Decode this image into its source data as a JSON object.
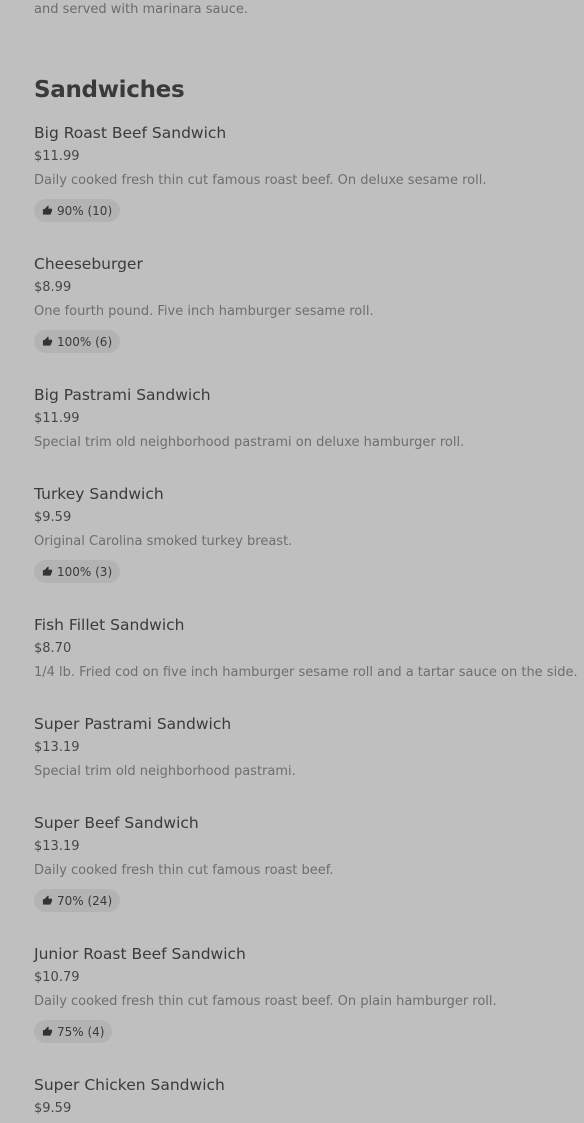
{
  "previous_item": {
    "description_tail": "and served with marinara sauce."
  },
  "section": {
    "title": "Sandwiches"
  },
  "items": [
    {
      "name": "Big Roast Beef Sandwich",
      "price": "$11.99",
      "description": "Daily cooked fresh thin cut famous roast beef. On deluxe sesame roll.",
      "rating": "90% (10)"
    },
    {
      "name": "Cheeseburger",
      "price": "$8.99",
      "description": "One fourth pound. Five inch hamburger sesame roll.",
      "rating": "100% (6)"
    },
    {
      "name": "Big Pastrami Sandwich",
      "price": "$11.99",
      "description": "Special trim old neighborhood pastrami on deluxe hamburger roll.",
      "rating": null
    },
    {
      "name": "Turkey Sandwich",
      "price": "$9.59",
      "description": "Original Carolina smoked turkey breast.",
      "rating": "100% (3)"
    },
    {
      "name": "Fish Fillet Sandwich",
      "price": "$8.70",
      "description": "1/4 lb. Fried cod on five inch hamburger sesame roll and a tartar sauce on the side.",
      "rating": null
    },
    {
      "name": "Super Pastrami Sandwich",
      "price": "$13.19",
      "description": "Special trim old neighborhood pastrami.",
      "rating": null
    },
    {
      "name": "Super Beef Sandwich",
      "price": "$13.19",
      "description": "Daily cooked fresh thin cut famous roast beef.",
      "rating": "70% (24)"
    },
    {
      "name": "Junior Roast Beef Sandwich",
      "price": "$10.79",
      "description": "Daily cooked fresh thin cut famous roast beef. On plain hamburger roll.",
      "rating": "75% (4)"
    },
    {
      "name": "Super Chicken Sandwich",
      "price": "$9.59",
      "description": "",
      "rating": null
    }
  ],
  "icons": {
    "rating": "thumbs-up-icon"
  }
}
